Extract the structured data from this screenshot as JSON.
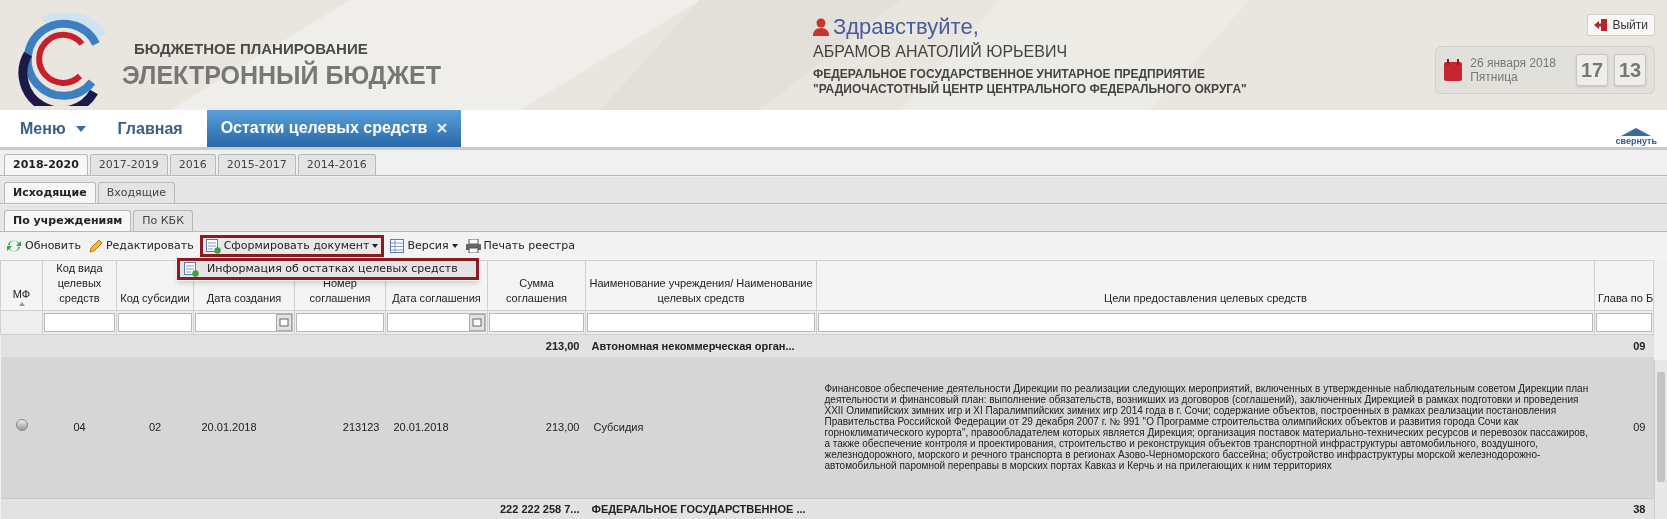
{
  "header": {
    "subtitle": "БЮДЖЕТНОЕ ПЛАНИРОВАНИЕ",
    "title": "ЭЛЕКТРОННЫЙ БЮДЖЕТ",
    "greeting": "Здравствуйте,",
    "user": "АБРАМОВ АНАТОЛИЙ ЮРЬЕВИЧ",
    "organization": [
      "ФЕДЕРАЛЬНОЕ ГОСУДАРСТВЕННОЕ УНИТАРНОЕ ПРЕДПРИЯТИЕ",
      "\"РАДИОЧАСТОТНЫЙ ЦЕНТР ЦЕНТРАЛЬНОГО ФЕДЕРАЛЬНОГО ОКРУГА\""
    ],
    "logout": "Выйти",
    "date": "26 января 2018",
    "weekday": "Пятница",
    "hours": "17",
    "minutes": "13"
  },
  "nav": {
    "menu": "Меню",
    "tabs": [
      {
        "label": "Главная",
        "selected": false,
        "closable": false
      },
      {
        "label": "Остатки целевых средств",
        "selected": true,
        "closable": true
      }
    ],
    "collapse": "свернуть"
  },
  "tab_rows": [
    [
      {
        "label": "2018-2020",
        "selected": true
      },
      {
        "label": "2017-2019",
        "selected": false
      },
      {
        "label": "2016",
        "selected": false
      },
      {
        "label": "2015-2017",
        "selected": false
      },
      {
        "label": "2014-2016",
        "selected": false
      }
    ],
    [
      {
        "label": "Исходящие",
        "selected": true
      },
      {
        "label": "Входящие",
        "selected": false
      }
    ],
    [
      {
        "label": "По учреждениям",
        "selected": true
      },
      {
        "label": "По КБК",
        "selected": false
      }
    ]
  ],
  "toolbar": [
    {
      "kind": "refresh",
      "label": "Обновить",
      "dropdown": false,
      "highlighted": false
    },
    {
      "kind": "edit",
      "label": "Редактировать",
      "dropdown": false,
      "highlighted": false
    },
    {
      "kind": "document",
      "label": "Сформировать документ",
      "dropdown": true,
      "highlighted": true
    },
    {
      "kind": "table",
      "label": "Версия",
      "dropdown": true,
      "highlighted": false
    },
    {
      "kind": "print",
      "label": "Печать реестра",
      "dropdown": false,
      "highlighted": false
    }
  ],
  "dropdown_menu": [
    {
      "label": "Информация об остатках целевых средств",
      "highlighted": true
    }
  ],
  "table": {
    "columns": [
      {
        "label": "МФ",
        "kind": "plain",
        "sorted": true
      },
      {
        "label": "Код вида целевых средств",
        "kind": "text",
        "sorted": false
      },
      {
        "label": "Код субсидии",
        "kind": "text",
        "sorted": false
      },
      {
        "label": "Дата создания",
        "kind": "date",
        "sorted": false
      },
      {
        "label": "Номер соглашения",
        "kind": "text",
        "sorted": false
      },
      {
        "label": "Дата соглашения",
        "kind": "date",
        "sorted": false
      },
      {
        "label": "Сумма соглашения",
        "kind": "text",
        "sorted": false
      },
      {
        "label": "Наименование учреждения/ Наименование целевых средств",
        "kind": "text",
        "sorted": false
      },
      {
        "label": "Цели предоставления целевых средств",
        "kind": "text",
        "sorted": false
      },
      {
        "label": "Глава по Б",
        "kind": "text",
        "sorted": false
      }
    ],
    "rows": [
      {
        "kind": "group",
        "sum": "213,00",
        "name": "Автономная некоммерческая орган...",
        "chapter": "09"
      },
      {
        "kind": "data",
        "selected": true,
        "checked": false,
        "cells": [
          "04",
          "02",
          "20.01.2018",
          "213123",
          "20.01.2018",
          "213,00",
          "Субсидия",
          "Финансовое обеспечение деятельности Дирекции по реализации следующих мероприятий, включенных в утвержденные наблюдательным советом Дирекции план деятельности и финансовый план: выполнение обязательств, возникших из договоров (соглашений), заключенных Дирекцией в рамках подготовки и проведения XXII Олимпийских зимних игр и XI Паралимпийских зимних игр 2014 года в г. Сочи; содержание объектов, построенных в рамках реализации постановления Правительства Российской Федерации от 29 декабря 2007 г. № 991 \"О Программе строительства олимпийских объектов и развития города Сочи как горноклиматического курорта\", правообладателем которых является Дирекция; организация поставок материально-технических ресурсов и перевозок пассажиров, а также обеспечение контроля и проектирования, строительство и реконструкция объектов транспортной инфраструктуры автомобильного, воздушного, железнодорожного, морского и речного транспорта в регионах Азово-Черноморского бассейна; обустройство инфраструктуры морской железнодорожно-автомобильной паромной переправы в морских портах Кавказ и Керчь и на прилегающих к ним территориях",
          "09"
        ]
      },
      {
        "kind": "group",
        "sum": "222 222 258 7...",
        "name": "ФЕДЕРАЛЬНОЕ ГОСУДАРСТВЕННОЕ ...",
        "chapter": "38"
      }
    ]
  }
}
